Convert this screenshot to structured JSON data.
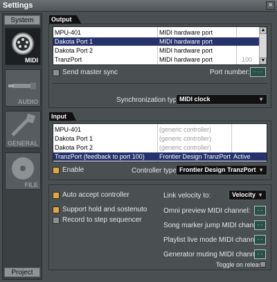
{
  "window": {
    "title": "Settings",
    "close_glyph": "×"
  },
  "sidebar": {
    "top_button": "System",
    "bottom_button": "Project",
    "categories": [
      {
        "label": "MIDI",
        "icon": "midi-plug-icon",
        "active": true
      },
      {
        "label": "AUDIO",
        "icon": "audio-jack-icon",
        "active": false
      },
      {
        "label": "GENERAL",
        "icon": "wrench-icon",
        "active": false
      },
      {
        "label": "FILE",
        "icon": "disc-icon",
        "active": false
      }
    ]
  },
  "output": {
    "header": "Output",
    "ports": [
      {
        "name": "MPU-401",
        "type": "MIDI hardware port",
        "port": "",
        "selected": false
      },
      {
        "name": "Dakota Port 1",
        "type": "MIDI hardware port",
        "port": "",
        "selected": true
      },
      {
        "name": "Dakota Port 2",
        "type": "MIDI hardware port",
        "port": "",
        "selected": false
      },
      {
        "name": "TranzPort",
        "type": "MIDI hardware port",
        "port": "100",
        "selected": false
      }
    ],
    "send_master_sync": "Send master sync",
    "port_number_label": "Port number:",
    "port_number_value": "---",
    "sync_type_label": "Synchronization type:",
    "sync_type_value": "MIDI clock"
  },
  "input": {
    "header": "Input",
    "ports": [
      {
        "name": "MPU-401",
        "controller": "(generic controller)",
        "status": "",
        "selected": false
      },
      {
        "name": "Dakota Port 1",
        "controller": "(generic controller)",
        "status": "",
        "selected": false
      },
      {
        "name": "Dakota Port 2",
        "controller": "(generic controller)",
        "status": "",
        "selected": false
      },
      {
        "name": "TranzPort (feedback to port 100)",
        "controller": "Frontier Design TranzPort",
        "status": "Active",
        "selected": true
      }
    ],
    "enable_label": "Enable",
    "controller_type_label": "Controller type:",
    "controller_type_value": "Frontier Design TranzPort"
  },
  "options": {
    "auto_accept": "Auto accept controller",
    "support_hold": "Support hold and sostenuto",
    "record_step": "Record to step sequencer",
    "link_velocity_label": "Link velocity to:",
    "link_velocity_value": "Velocity",
    "omni_label": "Omni preview MIDI channel:",
    "omni_value": "--",
    "song_marker_label": "Song marker jump MIDI channel:",
    "song_marker_value": "--",
    "playlist_label": "Playlist live mode MIDI channel:",
    "playlist_value": "--",
    "generator_label": "Generator muting MIDI channel:",
    "generator_value": "--",
    "toggle_label": "Toggle on release"
  },
  "colors": {
    "accent": "#e3a83b",
    "selection": "#25326c",
    "lcd": "#2c4f45"
  }
}
